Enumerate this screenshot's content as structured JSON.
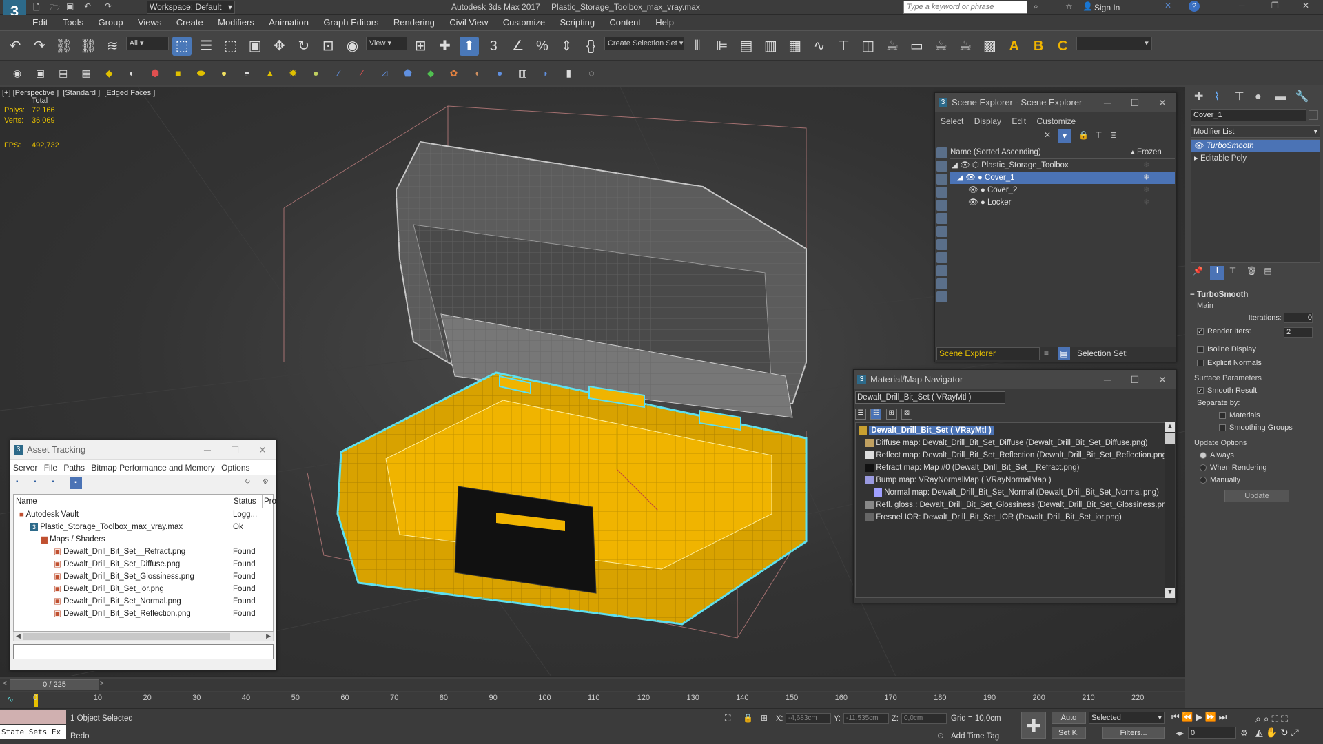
{
  "titlebar": {
    "workspace_label": "Workspace: Default",
    "app_title": "Autodesk 3ds Max 2017",
    "file_title": "Plastic_Storage_Toolbox_max_vray.max",
    "search_placeholder": "Type a keyword or phrase",
    "sign_in": "Sign In"
  },
  "menu": [
    "Edit",
    "Tools",
    "Group",
    "Views",
    "Create",
    "Modifiers",
    "Animation",
    "Graph Editors",
    "Rendering",
    "Civil View",
    "Customize",
    "Scripting",
    "Content",
    "Help"
  ],
  "toolbar": {
    "selection_filter": "All",
    "ref_coord": "View",
    "selection_set": "Create Selection Set"
  },
  "viewport": {
    "label": "[+] [Perspective ]  [Standard ]  [Edged Faces ]",
    "stats_total": "Total",
    "polys_label": "Polys:",
    "polys_value": "72 166",
    "verts_label": "Verts:",
    "verts_value": "36 069",
    "fps_label": "FPS:",
    "fps_value": "492,732"
  },
  "scene_explorer": {
    "title": "Scene Explorer - Scene Explorer",
    "menu": [
      "Select",
      "Display",
      "Edit",
      "Customize"
    ],
    "col_name": "Name (Sorted Ascending)",
    "col_frozen": "▴ Frozen",
    "items": [
      "Plastic_Storage_Toolbox",
      "Cover_1",
      "Cover_2",
      "Locker"
    ],
    "footer_explorer": "Scene Explorer",
    "footer_selset": "Selection Set:"
  },
  "command_panel": {
    "object_name": "Cover_1",
    "modifier_list": "Modifier List",
    "stack": [
      "TurboSmooth",
      "Editable Poly"
    ],
    "rollout_title": "TurboSmooth",
    "main": "Main",
    "iterations_label": "Iterations:",
    "iterations_value": "0",
    "render_iters_label": "Render Iters:",
    "render_iters_value": "2",
    "isoline": "Isoline Display",
    "explicit_normals": "Explicit Normals",
    "surface_params": "Surface Parameters",
    "smooth_result": "Smooth Result",
    "separate_by": "Separate by:",
    "materials": "Materials",
    "smoothing_groups": "Smoothing Groups",
    "update_options": "Update Options",
    "always": "Always",
    "when_rendering": "When Rendering",
    "manually": "Manually",
    "update_button": "Update"
  },
  "material_navigator": {
    "title": "Material/Map Navigator",
    "current": "Dewalt_Drill_Bit_Set  ( VRayMtl )",
    "root": "Dewalt_Drill_Bit_Set  ( VRayMtl )",
    "maps": [
      "Diffuse map: Dewalt_Drill_Bit_Set_Diffuse (Dewalt_Drill_Bit_Set_Diffuse.png)",
      "Reflect map: Dewalt_Drill_Bit_Set_Reflection (Dewalt_Drill_Bit_Set_Reflection.png)",
      "Refract map: Map #0 (Dewalt_Drill_Bit_Set__Refract.png)",
      "Bump map: VRayNormalMap  ( VRayNormalMap )",
      "Normal map: Dewalt_Drill_Bit_Set_Normal (Dewalt_Drill_Bit_Set_Normal.png)",
      "Refl. gloss.: Dewalt_Drill_Bit_Set_Glossiness (Dewalt_Drill_Bit_Set_Glossiness.png)",
      "Fresnel IOR: Dewalt_Drill_Bit_Set_IOR (Dewalt_Drill_Bit_Set_ior.png)"
    ]
  },
  "asset_tracking": {
    "title": "Asset Tracking",
    "menu": [
      "Server",
      "File",
      "Paths",
      "Bitmap Performance and Memory",
      "Options"
    ],
    "col_name": "Name",
    "col_status": "Status",
    "col_proxy": "Pro",
    "rows": [
      {
        "name": "Autodesk Vault",
        "status": "Logg..."
      },
      {
        "name": "Plastic_Storage_Toolbox_max_vray.max",
        "status": "Ok"
      },
      {
        "name": "Maps / Shaders",
        "status": ""
      },
      {
        "name": "Dewalt_Drill_Bit_Set__Refract.png",
        "status": "Found"
      },
      {
        "name": "Dewalt_Drill_Bit_Set_Diffuse.png",
        "status": "Found"
      },
      {
        "name": "Dewalt_Drill_Bit_Set_Glossiness.png",
        "status": "Found"
      },
      {
        "name": "Dewalt_Drill_Bit_Set_ior.png",
        "status": "Found"
      },
      {
        "name": "Dewalt_Drill_Bit_Set_Normal.png",
        "status": "Found"
      },
      {
        "name": "Dewalt_Drill_Bit_Set_Reflection.png",
        "status": "Found"
      }
    ]
  },
  "timeline": {
    "frame": "0 / 225",
    "ticks": [
      "0",
      "10",
      "20",
      "30",
      "40",
      "50",
      "60",
      "70",
      "80",
      "90",
      "100",
      "110",
      "120",
      "130",
      "140",
      "150",
      "160",
      "170",
      "180",
      "190",
      "200",
      "210",
      "220"
    ]
  },
  "status": {
    "state_sets": "State Sets Ex",
    "selected": "1 Object Selected",
    "last_action": "Redo",
    "x_label": "X:",
    "x_value": "-4,683cm",
    "y_label": "Y:",
    "y_value": "-11,535cm",
    "z_label": "Z:",
    "z_value": "0,0cm",
    "grid": "Grid = 10,0cm",
    "add_time_tag": "Add Time Tag",
    "auto": "Auto",
    "set_key": "Set K.",
    "key_mode": "Selected",
    "filters": "Filters...",
    "frame_value": "0"
  },
  "colors": {
    "selection_blue": "#4b73b5",
    "toolbox_yellow": "#f0b400",
    "wire_grey": "#c8c8c8",
    "scene_explorer_label": "#e8c000"
  }
}
